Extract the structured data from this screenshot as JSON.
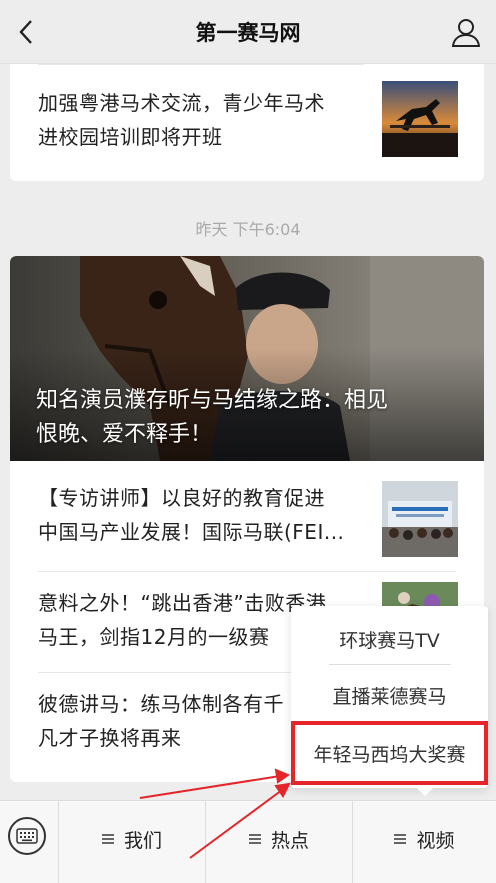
{
  "nav": {
    "title": "第一赛马网",
    "back_icon": "chevron-left-icon",
    "profile_icon": "person-icon"
  },
  "articles": [
    {
      "line1": "加强粤港马术交流，青少年马术",
      "line2": "进校园培训即将开班"
    }
  ],
  "timestamp": "昨天 下午6:04",
  "hero": {
    "line1": "知名演员濮存昕与马结缘之路：相见",
    "line2": "恨晚、爱不释手！"
  },
  "list": [
    {
      "line1": "【专访讲师】以良好的教育促进",
      "line2": "中国马产业发展！国际马联(FEI..."
    },
    {
      "line1": "意料之外！“跳出香港”击败香港",
      "line2": "马王，剑指12月的一级赛"
    },
    {
      "line1": "彼德讲马：练马体制各有千",
      "line2": "凡才子换将再来"
    }
  ],
  "popup": {
    "items": [
      "环球赛马TV",
      "直播莱德赛马",
      "年轻马西坞大奖赛"
    ]
  },
  "tabbar": {
    "tabs": [
      "我们",
      "热点",
      "视频"
    ],
    "keyboard_icon": "keyboard-icon"
  },
  "colors": {
    "highlight": "#e4252a",
    "annotation_arrow": "#e4252a"
  }
}
